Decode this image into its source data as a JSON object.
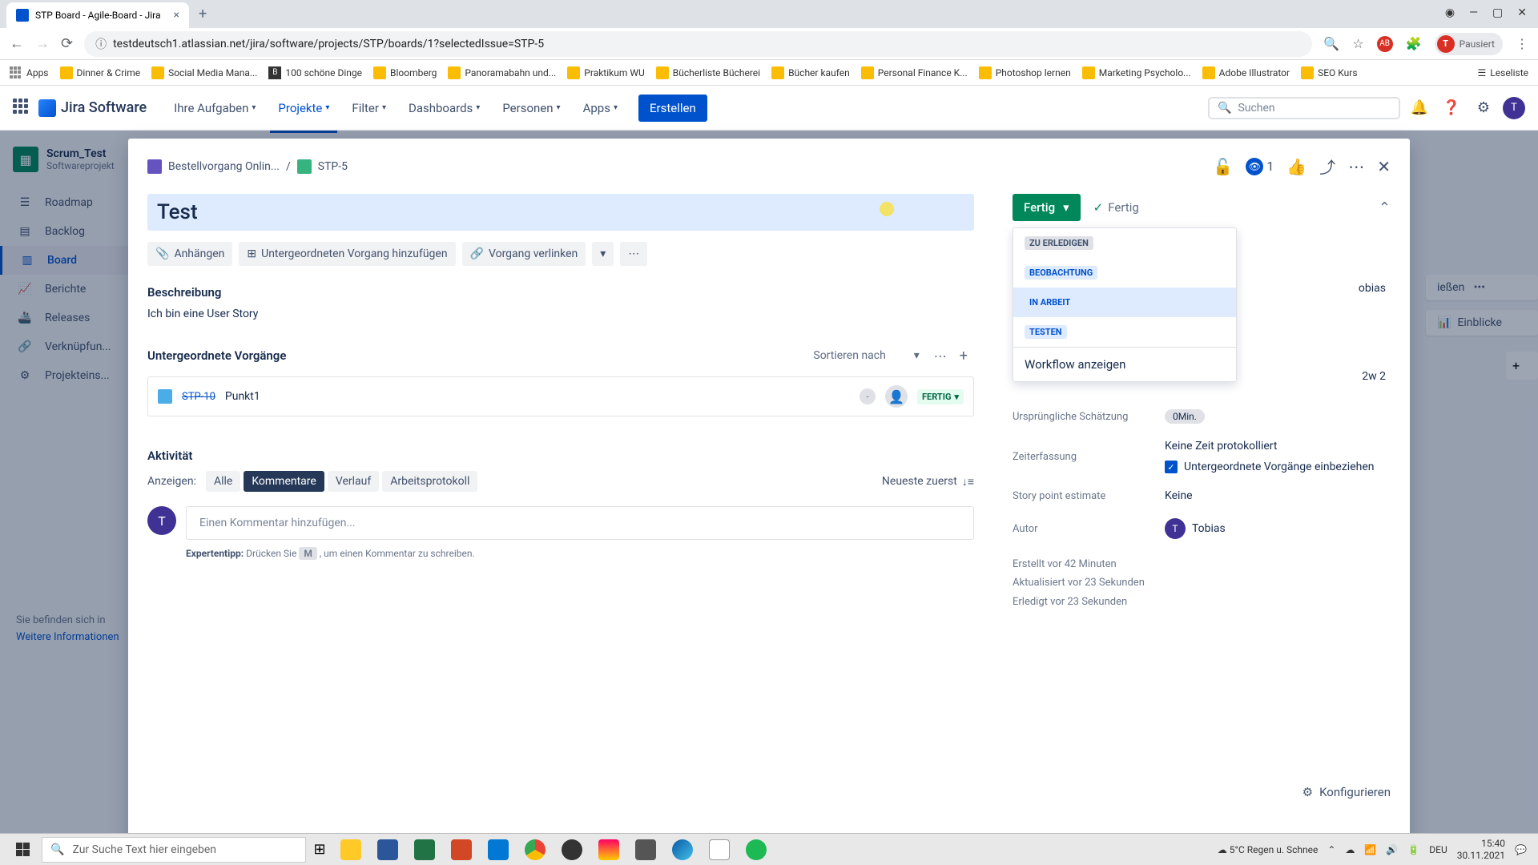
{
  "browser": {
    "tab_title": "STP Board - Agile-Board - Jira",
    "url": "testdeutsch1.atlassian.net/jira/software/projects/STP/boards/1?selectedIssue=STP-5",
    "profile_status": "Pausiert",
    "bookmarks": [
      "Apps",
      "Dinner & Crime",
      "Social Media Mana...",
      "100 schöne Dinge",
      "Bloomberg",
      "Panoramabahn und...",
      "Praktikum WU",
      "Bücherliste Bücherei",
      "Bücher kaufen",
      "Personal Finance K...",
      "Photoshop lernen",
      "Marketing Psycholo...",
      "Adobe Illustrator",
      "SEO Kurs"
    ],
    "reading_list": "Leseliste"
  },
  "jira_nav": {
    "product": "Jira Software",
    "items": [
      "Ihre Aufgaben",
      "Projekte",
      "Filter",
      "Dashboards",
      "Personen",
      "Apps"
    ],
    "create": "Erstellen",
    "search_placeholder": "Suchen"
  },
  "sidebar": {
    "project_name": "Scrum_Test",
    "project_type": "Softwareprojekt",
    "items": [
      "Roadmap",
      "Backlog",
      "Board",
      "Berichte",
      "Releases",
      "Verknüpfun...",
      "Projekteins..."
    ],
    "footer": "Sie befinden sich in",
    "footer_link": "Weitere Informationen"
  },
  "board_floating": {
    "btn1_partial": "ießen",
    "insights": "Einblicke"
  },
  "issue": {
    "breadcrumb_epic": "Bestellvorgang Onlin...",
    "breadcrumb_key": "STP-5",
    "watch_count": "1",
    "title": "Test",
    "actions": {
      "attach": "Anhängen",
      "add_child": "Untergeordneten Vorgang hinzufügen",
      "link_issue": "Vorgang verlinken"
    },
    "description_label": "Beschreibung",
    "description_text": "Ich bin eine User Story",
    "subtasks_label": "Untergeordnete Vorgänge",
    "sort_by": "Sortieren nach",
    "subtask": {
      "key": "STP-10",
      "title": "Punkt1",
      "priority": "-",
      "status": "FERTIG"
    },
    "activity_label": "Aktivität",
    "show_label": "Anzeigen:",
    "tabs": [
      "Alle",
      "Kommentare",
      "Verlauf",
      "Arbeitsprotokoll"
    ],
    "newest_first": "Neueste zuerst",
    "comment_placeholder": "Einen Kommentar hinzufügen...",
    "pro_tip_label": "Expertentipp:",
    "pro_tip_pre": "Drücken Sie",
    "pro_tip_key": "M",
    "pro_tip_post": ", um einen Kommentar zu schreiben."
  },
  "right_panel": {
    "status_button": "Fertig",
    "status_done": "Fertig",
    "status_options": [
      "ZU ERLEDIGEN",
      "BEOBACHTUNG",
      "IN ARBEIT",
      "TESTEN"
    ],
    "workflow_link": "Workflow anzeigen",
    "assignee_name": "obias",
    "time_tracking": "2w 2",
    "fields": {
      "original_estimate_label": "Ursprüngliche Schätzung",
      "original_estimate_value": "0Min.",
      "time_tracking_label": "Zeiterfassung",
      "time_tracking_value": "Keine Zeit protokolliert",
      "include_subtasks": "Untergeordnete Vorgänge einbeziehen",
      "story_points_label": "Story point estimate",
      "story_points_value": "Keine",
      "author_label": "Autor",
      "author_value": "Tobias"
    },
    "timestamps": {
      "created": "Erstellt vor 42 Minuten",
      "updated": "Aktualisiert vor 23 Sekunden",
      "resolved": "Erledigt vor 23 Sekunden"
    },
    "configure": "Konfigurieren"
  },
  "taskbar": {
    "search_placeholder": "Zur Suche Text hier eingeben",
    "weather": "5°C  Regen u. Schnee",
    "lang": "DEU",
    "time": "15:40",
    "date": "30.11.2021"
  }
}
